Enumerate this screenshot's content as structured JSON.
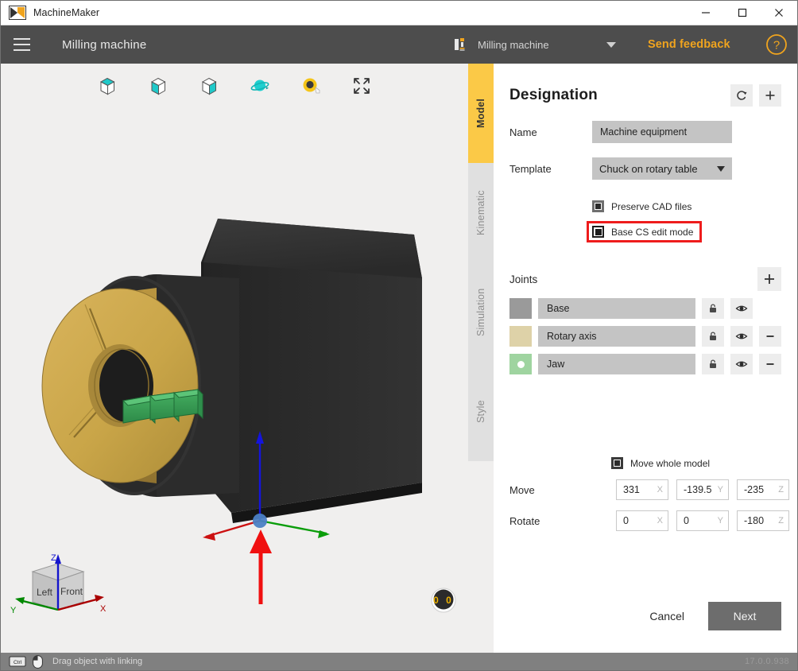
{
  "window": {
    "app_title": "MachineMaker",
    "logo_icon": "machinemaker-logo-icon",
    "minimize_label": "—",
    "maximize_label": "□",
    "close_label": "✕"
  },
  "header": {
    "menu_icon": "hamburger-menu-icon",
    "title": "Milling machine",
    "machine_icon": "milling-machine-icon",
    "machine_name": "Milling machine",
    "dropdown_icon": "chevron-down-icon",
    "feedback_label": "Send feedback",
    "feedback_color": "#f0a41e",
    "help_icon": "help-question-icon"
  },
  "viewport": {
    "toolbar": [
      {
        "name": "view-top-face-icon",
        "label": "Top face view"
      },
      {
        "name": "view-front-face-icon",
        "label": "Front face view"
      },
      {
        "name": "view-side-face-icon",
        "label": "Side face view"
      },
      {
        "name": "orbit-rotate-icon",
        "label": "Orbit / rotate"
      },
      {
        "name": "measure-tape-icon",
        "label": "Measure"
      },
      {
        "name": "fit-to-screen-icon",
        "label": "Fit to screen"
      }
    ],
    "viewcube": {
      "face_left": "Left",
      "face_front": "Front",
      "axis_x": "X",
      "axis_y": "Y",
      "axis_z": "Z",
      "color_x": "#cc0000",
      "color_y": "#009900",
      "color_z": "#0000cc"
    },
    "rotation_badge": "0 0",
    "annotation_arrow": "red-pointer-arrow",
    "model_colors": {
      "body": "#2b2b2b",
      "rotary_chuck": "#c9a646",
      "jaw": "#3aa355",
      "background": "#f0efee"
    }
  },
  "tabs": [
    {
      "label": "Model",
      "active": true
    },
    {
      "label": "Kinematic",
      "active": false
    },
    {
      "label": "Simulation",
      "active": false
    },
    {
      "label": "Style",
      "active": false
    }
  ],
  "panel": {
    "title": "Designation",
    "reset_icon": "reset-arrow-icon",
    "add_icon": "plus-icon",
    "name_label": "Name",
    "name_value": "Machine equipment",
    "name_placeholder": "Machine equipment",
    "template_label": "Template",
    "template_value": "Chuck on rotary table",
    "checkboxes": [
      {
        "label": "Preserve CAD files",
        "checked": true,
        "highlighted": false
      },
      {
        "label": "Base CS edit mode",
        "checked": true,
        "highlighted": true
      }
    ],
    "highlight_color": "#ee1c1c",
    "joints_title": "Joints",
    "joints_add_icon": "plus-icon",
    "joints": [
      {
        "name": "Base",
        "color": "#9a9a9a",
        "selected": false,
        "lock_icon": "lock-icon",
        "eye_icon": "eye-icon",
        "remove": false
      },
      {
        "name": "Rotary axis",
        "color": "#ded2a8",
        "selected": false,
        "lock_icon": "lock-icon",
        "eye_icon": "eye-icon",
        "remove": true
      },
      {
        "name": "Jaw",
        "color": "#9fd4a0",
        "selected": true,
        "lock_icon": "lock-icon",
        "eye_icon": "eye-icon",
        "remove": true
      }
    ],
    "remove_icon": "minus-icon",
    "move_whole_model_label": "Move whole model",
    "move_whole_model_checked": true,
    "move_label": "Move",
    "move": {
      "x": "331",
      "y": "-139.5",
      "z": "-235"
    },
    "rotate_label": "Rotate",
    "rotate": {
      "x": "0",
      "y": "0",
      "z": "-180"
    },
    "axis_x": "X",
    "axis_y": "Y",
    "axis_z": "Z",
    "cancel_label": "Cancel",
    "next_label": "Next"
  },
  "statusbar": {
    "key_icon": "ctrl-key-icon",
    "key_label": "Ctrl",
    "mouse_icon": "mouse-icon",
    "hint": "Drag object with linking",
    "version": "17.0.0.938"
  }
}
